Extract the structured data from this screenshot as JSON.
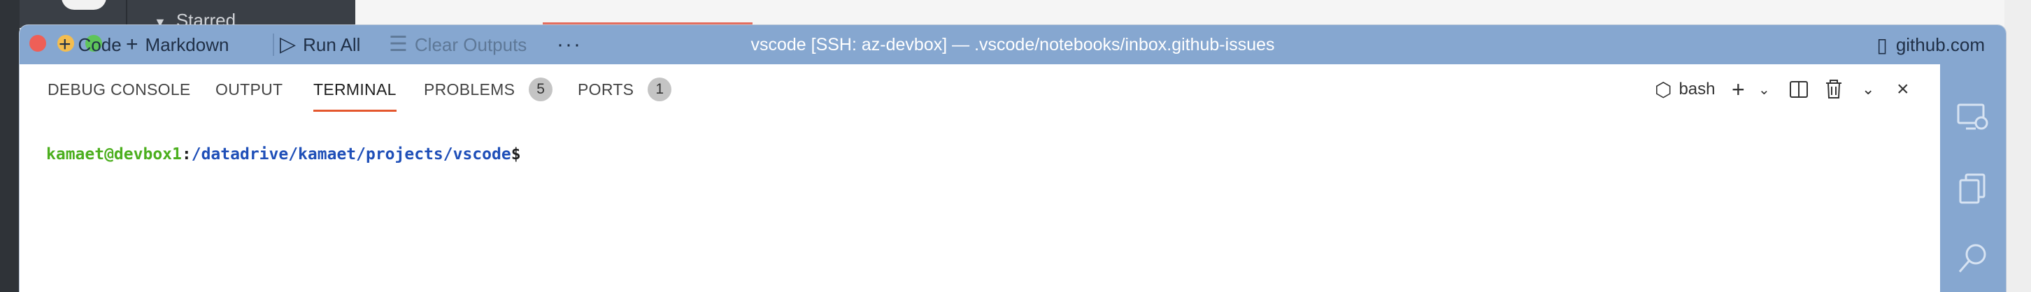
{
  "background": {
    "starred_label": "Starred"
  },
  "titlebar": {
    "code_label": "Code",
    "markdown_label": "Markdown",
    "run_all_label": "Run All",
    "clear_outputs_label": "Clear Outputs",
    "more_label": "···",
    "window_title": "vscode [SSH: az-devbox] — .vscode/notebooks/inbox.github-issues",
    "remote_label": "github.com"
  },
  "panel": {
    "tabs": [
      {
        "label": "DEBUG CONSOLE",
        "active": false
      },
      {
        "label": "OUTPUT",
        "active": false
      },
      {
        "label": "TERMINAL",
        "active": true
      },
      {
        "label": "PROBLEMS",
        "active": false,
        "badge": "5"
      },
      {
        "label": "PORTS",
        "active": false,
        "badge": "1"
      }
    ],
    "shell_label": "bash"
  },
  "terminal": {
    "user_host": "kamaet@devbox1",
    "colon": ":",
    "path": "/datadrive/kamaet/projects/vscode",
    "prompt": "$"
  },
  "colors": {
    "titlebar_bg": "#86a7d0",
    "active_tab_underline": "#e4572e",
    "terminal_user": "#4caf1e",
    "terminal_path": "#1f4fb8"
  },
  "icons": {
    "activity_bar": [
      "remote-explorer-icon",
      "copy-icon",
      "search-icon"
    ]
  }
}
